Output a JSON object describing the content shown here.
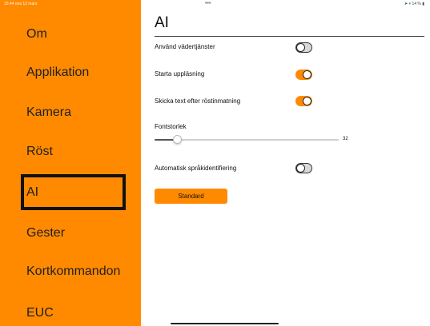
{
  "status_bar": {
    "left_text": "15:44  ons 12 mars",
    "battery_text": "14 %"
  },
  "sidebar": {
    "items": [
      {
        "label": "Om"
      },
      {
        "label": "Applikation"
      },
      {
        "label": "Kamera"
      },
      {
        "label": "Röst"
      },
      {
        "label": "AI",
        "selected": true
      },
      {
        "label": "Gester"
      },
      {
        "label": "Kortkommandon"
      },
      {
        "label": "EUC"
      }
    ]
  },
  "page": {
    "title": "AI",
    "settings": {
      "weather_services": {
        "label": "Använd vädertjänster",
        "enabled": false
      },
      "start_reading": {
        "label": "Starta uppläsning",
        "enabled": true
      },
      "send_after_voice": {
        "label": "Skicka text efter röstinmatning",
        "enabled": true
      },
      "font_size": {
        "label": "Fontstorlek",
        "value": 32,
        "min_fraction": 0.12
      },
      "auto_language": {
        "label": "Automatisk språkidentifiering",
        "enabled": false
      }
    },
    "standard_button": "Standard"
  },
  "colors": {
    "accent": "#ff8a00",
    "highlight_border": "#111111"
  }
}
